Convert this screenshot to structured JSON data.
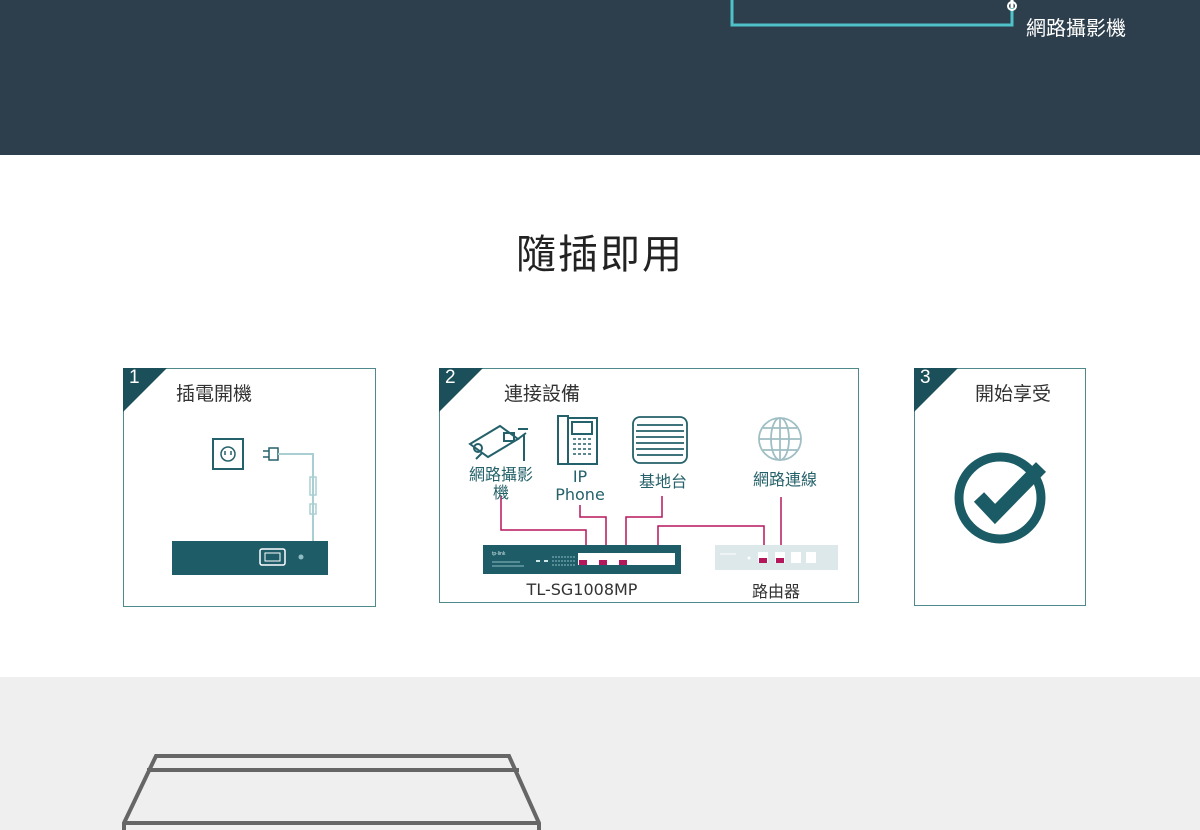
{
  "top_banner": {
    "camera_label": "網路攝影機"
  },
  "section": {
    "title": "隨插即用"
  },
  "steps": [
    {
      "number": "1",
      "title": "插電開機"
    },
    {
      "number": "2",
      "title": "連接設備",
      "devices": {
        "camera": "網路攝影機",
        "phone": "IP\nPhone",
        "access_point": "基地台",
        "internet": "網路連線"
      },
      "switch_model": "TL-SG1008MP",
      "router": "路由器"
    },
    {
      "number": "3",
      "title": "開始享受"
    }
  ],
  "colors": {
    "dark_band": "#2d3f4c",
    "accent_teal": "#4fc1c8",
    "icon_teal": "#1b5b65",
    "poe_magenta": "#b5175d",
    "card_border": "#4e8a8c",
    "light_band": "#efefef"
  }
}
